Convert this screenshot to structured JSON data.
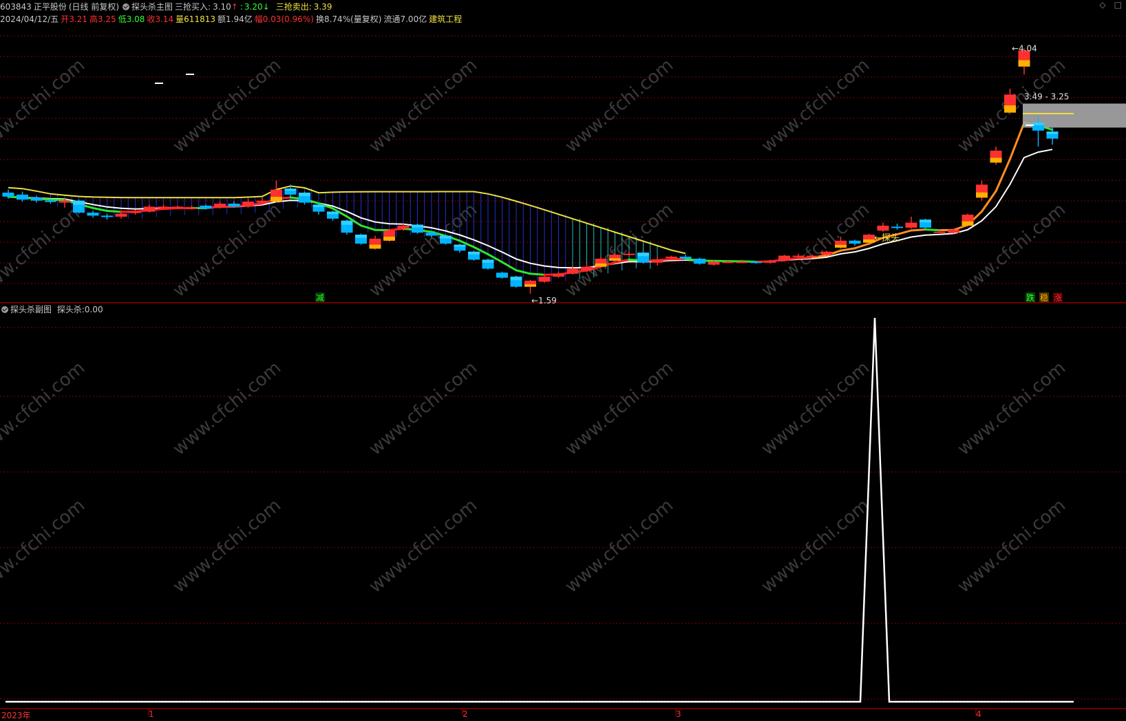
{
  "header": {
    "code": "603843",
    "name": "正平股份",
    "period": "(日线 前复权)",
    "main_indicator": "探头杀主图",
    "buy_label": "三抢买入:",
    "buy_value": "3.10",
    "buy_arrow": "↑",
    "mid_label": ":",
    "mid_value": "3.20",
    "mid_arrow": "↓",
    "sell_label": "三抢卖出:",
    "sell_value": "3.39"
  },
  "quote": {
    "date": "2024/04/12/五",
    "open_label": "开",
    "open": "3.21",
    "high_label": "高",
    "high": "3.25",
    "low_label": "低",
    "low": "3.08",
    "close_label": "收",
    "close": "3.14",
    "volume_label": "量",
    "volume": "611813",
    "amount_label": "额",
    "amount": "1.94亿",
    "change_label": "幅",
    "change": "0.03(0.96%)",
    "turnover_label": "换",
    "turnover": "8.74%(量复权)",
    "float_label": "流通",
    "float": "7.00亿",
    "industry": "建筑工程"
  },
  "annotations": {
    "high_mark": "4.04",
    "low_mark": "1.59",
    "range_box": "3.49 - 3.25",
    "probe_label": "←探头",
    "signal_reduce": "减",
    "signal_down": "跌",
    "signal_steady": "稳",
    "signal_up": "涨"
  },
  "subchart": {
    "title": "探头杀副图",
    "value_label": "探头杀:",
    "value": "0.00"
  },
  "xaxis": {
    "labels": [
      "2023年",
      "1",
      "2",
      "3",
      "4"
    ]
  },
  "watermark": "www.cfchi.com",
  "colors": {
    "up": "#ff3030",
    "down": "#00b4ff",
    "yellow_line": "#f0e040",
    "green_line": "#2ee52e",
    "red_line": "#ff2020",
    "orange_line": "#ff9020",
    "white_line": "#ffffff",
    "grid": "#8b0000"
  },
  "chart_data": {
    "type": "candlestick",
    "title": "正平股份 603843 日线",
    "price_range": [
      1.5,
      4.25
    ],
    "candles": [
      {
        "o": 2.6,
        "c": 2.56,
        "h": 2.63,
        "l": 2.54
      },
      {
        "o": 2.58,
        "c": 2.53,
        "h": 2.61,
        "l": 2.51
      },
      {
        "o": 2.55,
        "c": 2.52,
        "h": 2.57,
        "l": 2.5
      },
      {
        "o": 2.52,
        "c": 2.51,
        "h": 2.54,
        "l": 2.49
      },
      {
        "o": 2.5,
        "c": 2.52,
        "h": 2.54,
        "l": 2.45
      },
      {
        "o": 2.52,
        "c": 2.4,
        "h": 2.53,
        "l": 2.39
      },
      {
        "o": 2.4,
        "c": 2.37,
        "h": 2.42,
        "l": 2.35
      },
      {
        "o": 2.37,
        "c": 2.36,
        "h": 2.39,
        "l": 2.33
      },
      {
        "o": 2.36,
        "c": 2.39,
        "h": 2.41,
        "l": 2.34
      },
      {
        "o": 2.4,
        "c": 2.41,
        "h": 2.43,
        "l": 2.38
      },
      {
        "o": 2.41,
        "c": 2.46,
        "h": 2.48,
        "l": 2.4
      },
      {
        "o": 2.45,
        "c": 2.46,
        "h": 2.48,
        "l": 2.44
      },
      {
        "o": 2.45,
        "c": 2.46,
        "h": 2.47,
        "l": 2.44
      },
      {
        "o": 2.45,
        "c": 2.45,
        "h": 2.47,
        "l": 2.43
      },
      {
        "o": 2.47,
        "c": 2.44,
        "h": 2.48,
        "l": 2.43
      },
      {
        "o": 2.45,
        "c": 2.49,
        "h": 2.51,
        "l": 2.44
      },
      {
        "o": 2.49,
        "c": 2.46,
        "h": 2.51,
        "l": 2.45
      },
      {
        "o": 2.46,
        "c": 2.51,
        "h": 2.54,
        "l": 2.45
      },
      {
        "o": 2.5,
        "c": 2.52,
        "h": 2.55,
        "l": 2.49
      },
      {
        "o": 2.51,
        "c": 2.63,
        "h": 2.72,
        "l": 2.5
      },
      {
        "o": 2.64,
        "c": 2.58,
        "h": 2.68,
        "l": 2.56
      },
      {
        "o": 2.6,
        "c": 2.5,
        "h": 2.61,
        "l": 2.48
      },
      {
        "o": 2.48,
        "c": 2.41,
        "h": 2.5,
        "l": 2.38
      },
      {
        "o": 2.41,
        "c": 2.34,
        "h": 2.42,
        "l": 2.32
      },
      {
        "o": 2.32,
        "c": 2.2,
        "h": 2.33,
        "l": 2.18
      },
      {
        "o": 2.18,
        "c": 2.09,
        "h": 2.19,
        "l": 2.08
      },
      {
        "o": 2.04,
        "c": 2.14,
        "h": 2.17,
        "l": 2.03
      },
      {
        "o": 2.12,
        "c": 2.22,
        "h": 2.24,
        "l": 2.11
      },
      {
        "o": 2.24,
        "c": 2.27,
        "h": 2.29,
        "l": 2.22
      },
      {
        "o": 2.28,
        "c": 2.2,
        "h": 2.29,
        "l": 2.19
      },
      {
        "o": 2.2,
        "c": 2.17,
        "h": 2.21,
        "l": 2.15
      },
      {
        "o": 2.17,
        "c": 2.09,
        "h": 2.18,
        "l": 2.08
      },
      {
        "o": 2.08,
        "c": 2.02,
        "h": 2.09,
        "l": 2.0
      },
      {
        "o": 2.01,
        "c": 1.93,
        "h": 2.02,
        "l": 1.92
      },
      {
        "o": 1.93,
        "c": 1.84,
        "h": 1.94,
        "l": 1.83
      },
      {
        "o": 1.8,
        "c": 1.75,
        "h": 1.81,
        "l": 1.74
      },
      {
        "o": 1.76,
        "c": 1.66,
        "h": 1.77,
        "l": 1.65
      },
      {
        "o": 1.66,
        "c": 1.72,
        "h": 1.73,
        "l": 1.59
      },
      {
        "o": 1.71,
        "c": 1.76,
        "h": 1.77,
        "l": 1.7
      },
      {
        "o": 1.76,
        "c": 1.79,
        "h": 1.81,
        "l": 1.75
      },
      {
        "o": 1.79,
        "c": 1.84,
        "h": 1.87,
        "l": 1.78
      },
      {
        "o": 1.82,
        "c": 1.86,
        "h": 1.89,
        "l": 1.81
      },
      {
        "o": 1.86,
        "c": 1.94,
        "h": 1.96,
        "l": 1.85
      },
      {
        "o": 1.92,
        "c": 1.98,
        "h": 2.0,
        "l": 1.91
      },
      {
        "o": 1.99,
        "c": 1.99,
        "h": 2.01,
        "l": 1.97
      },
      {
        "o": 2.0,
        "c": 1.9,
        "h": 2.02,
        "l": 1.89
      },
      {
        "o": 1.9,
        "c": 1.93,
        "h": 1.96,
        "l": 1.87
      },
      {
        "o": 1.95,
        "c": 1.96,
        "h": 1.97,
        "l": 1.94
      },
      {
        "o": 1.96,
        "c": 1.94,
        "h": 1.98,
        "l": 1.93
      },
      {
        "o": 1.94,
        "c": 1.89,
        "h": 1.95,
        "l": 1.88
      },
      {
        "o": 1.88,
        "c": 1.91,
        "h": 1.92,
        "l": 1.87
      },
      {
        "o": 1.91,
        "c": 1.91,
        "h": 1.92,
        "l": 1.9
      },
      {
        "o": 1.91,
        "c": 1.91,
        "h": 1.93,
        "l": 1.9
      },
      {
        "o": 1.91,
        "c": 1.9,
        "h": 1.92,
        "l": 1.89
      },
      {
        "o": 1.9,
        "c": 1.92,
        "h": 1.93,
        "l": 1.89
      },
      {
        "o": 1.92,
        "c": 1.97,
        "h": 1.98,
        "l": 1.91
      },
      {
        "o": 1.97,
        "c": 1.97,
        "h": 1.99,
        "l": 1.94
      },
      {
        "o": 1.97,
        "c": 1.97,
        "h": 1.98,
        "l": 1.96
      },
      {
        "o": 1.98,
        "c": 2.01,
        "h": 2.02,
        "l": 1.97
      },
      {
        "o": 2.05,
        "c": 2.12,
        "h": 2.16,
        "l": 2.04
      },
      {
        "o": 2.12,
        "c": 2.09,
        "h": 2.13,
        "l": 2.07
      },
      {
        "o": 2.1,
        "c": 2.18,
        "h": 2.19,
        "l": 2.09
      },
      {
        "o": 2.22,
        "c": 2.27,
        "h": 2.3,
        "l": 2.21
      },
      {
        "o": 2.26,
        "c": 2.25,
        "h": 2.29,
        "l": 2.23
      },
      {
        "o": 2.25,
        "c": 2.3,
        "h": 2.36,
        "l": 2.24
      },
      {
        "o": 2.33,
        "c": 2.25,
        "h": 2.34,
        "l": 2.24
      },
      {
        "o": 2.21,
        "c": 2.21,
        "h": 2.23,
        "l": 2.2
      },
      {
        "o": 2.2,
        "c": 2.23,
        "h": 2.24,
        "l": 2.19
      },
      {
        "o": 2.27,
        "c": 2.38,
        "h": 2.39,
        "l": 2.26
      },
      {
        "o": 2.55,
        "c": 2.68,
        "h": 2.72,
        "l": 2.52
      },
      {
        "o": 2.9,
        "c": 3.02,
        "h": 3.06,
        "l": 2.88
      },
      {
        "o": 3.4,
        "c": 3.58,
        "h": 3.64,
        "l": 3.52
      },
      {
        "o": 3.86,
        "c": 4.02,
        "h": 4.04,
        "l": 3.78
      },
      {
        "o": 3.3,
        "c": 3.22,
        "h": 3.36,
        "l": 3.06
      },
      {
        "o": 3.21,
        "c": 3.14,
        "h": 3.25,
        "l": 3.08
      }
    ],
    "subchart_series": {
      "name": "探头杀",
      "note": "single spike to 1.0 near late March, 0 elsewhere"
    }
  }
}
